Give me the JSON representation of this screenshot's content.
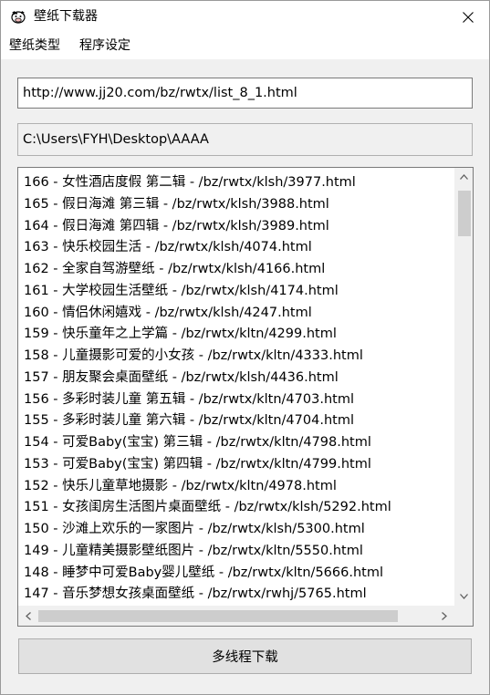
{
  "window": {
    "title": "壁纸下载器"
  },
  "menu": [
    "壁纸类型",
    "程序设定"
  ],
  "url_field": {
    "value": "http://www.jj20.com/bz/rwtx/list_8_1.html"
  },
  "path_field": {
    "value": "C:\\Users\\FYH\\Desktop\\AAAA"
  },
  "list": [
    "166 - 女性酒店度假 第二辑 - /bz/rwtx/klsh/3977.html",
    "165 - 假日海滩 第三辑 - /bz/rwtx/klsh/3988.html",
    "164 - 假日海滩 第四辑 - /bz/rwtx/klsh/3989.html",
    "163 - 快乐校园生活 - /bz/rwtx/klsh/4074.html",
    "162 - 全家自驾游壁纸 - /bz/rwtx/klsh/4166.html",
    "161 - 大学校园生活壁纸 - /bz/rwtx/klsh/4174.html",
    "160 - 情侣休闲嬉戏 - /bz/rwtx/klsh/4247.html",
    "159 - 快乐童年之上学篇 - /bz/rwtx/kltn/4299.html",
    "158 - 儿童摄影可爱的小女孩 - /bz/rwtx/kltn/4333.html",
    "157 - 朋友聚会桌面壁纸 - /bz/rwtx/klsh/4436.html",
    "156 - 多彩时装儿童 第五辑 - /bz/rwtx/kltn/4703.html",
    "155 - 多彩时装儿童 第六辑 - /bz/rwtx/kltn/4704.html",
    "154 - 可爱Baby(宝宝) 第三辑 - /bz/rwtx/kltn/4798.html",
    "153 - 可爱Baby(宝宝) 第四辑 - /bz/rwtx/kltn/4799.html",
    "152 - 快乐儿童草地摄影 - /bz/rwtx/kltn/4978.html",
    "151 - 女孩闺房生活图片桌面壁纸 - /bz/rwtx/klsh/5292.html",
    "150 - 沙滩上欢乐的一家图片 - /bz/rwtx/klsh/5300.html",
    "149 - 儿童精美摄影壁纸图片 - /bz/rwtx/kltn/5550.html",
    "148 - 睡梦中可爱Baby婴儿壁纸 - /bz/rwtx/kltn/5666.html",
    "147 - 音乐梦想女孩桌面壁纸 - /bz/rwtx/rwhj/5765.html"
  ],
  "download_button": {
    "label": "多线程下载"
  },
  "icons": {
    "app": "cow-icon",
    "close": "close-icon",
    "scroll_up": "scroll-up-arrow-icon",
    "scroll_down": "scroll-down-arrow-icon",
    "scroll_left": "scroll-left-arrow-icon",
    "scroll_right": "scroll-right-arrow-icon"
  },
  "colors": {
    "window_bg": "#f0f0f0",
    "titlebar_bg": "#ffffff",
    "button_bg": "#e1e1e1",
    "scroll_thumb": "#cdcdcd"
  }
}
